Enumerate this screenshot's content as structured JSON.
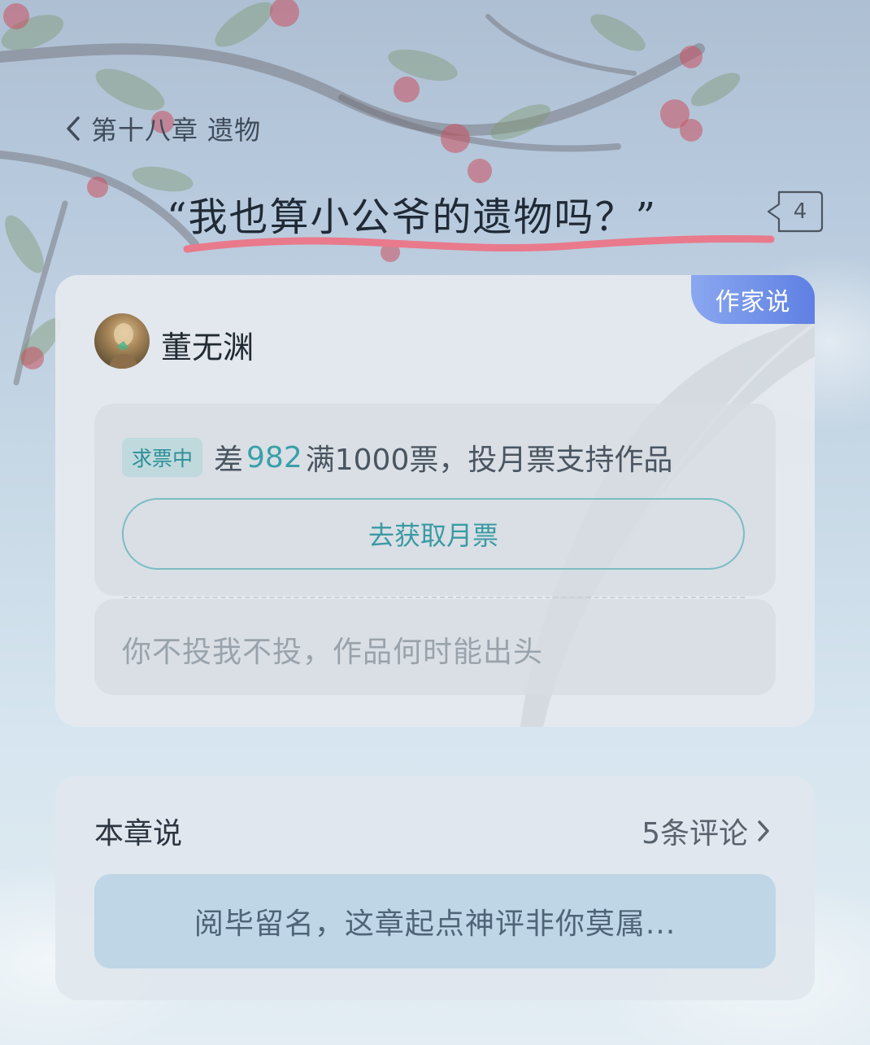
{
  "nav": {
    "back_label": "第十八章 遗物"
  },
  "header": {
    "quote": "“我也算小公爷的遗物吗？”",
    "comment_count": "4"
  },
  "author_card": {
    "badge": "作家说",
    "author_name": "董无渊",
    "vote": {
      "tag": "求票中",
      "prefix": "差",
      "remaining": "982",
      "suffix": "满1000票，投月票支持作品",
      "button_label": "去获取月票"
    },
    "message": "你不投我不投，作品何时能出头"
  },
  "chapter_comments": {
    "title": "本章说",
    "count_label": "5条评论",
    "input_placeholder": "阅毕留名，这章起点神评非你莫属..."
  },
  "colors": {
    "accent_teal": "#3a9fa8",
    "badge_blue": "#6f8fe8",
    "underline_red": "#e87a8c"
  },
  "icons": [
    "back-chevron-icon",
    "comment-bubble-icon",
    "feather-icon",
    "chevron-right-icon"
  ]
}
